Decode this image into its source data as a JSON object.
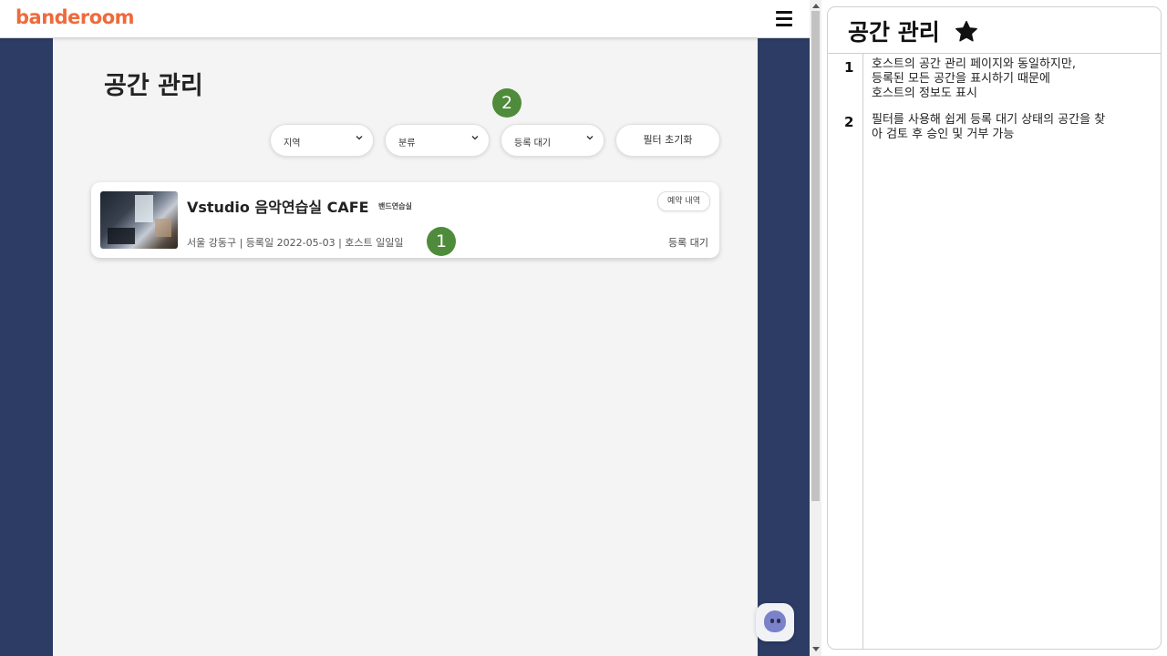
{
  "header": {
    "logo": "banderoom"
  },
  "page": {
    "title": "공간 관리"
  },
  "filters": {
    "region": "지역",
    "category": "분류",
    "status": "등록 대기",
    "reset": "필터 초기화"
  },
  "callouts": [
    "1",
    "2"
  ],
  "space_card": {
    "title": "Vstudio 음악연습실 CAFE",
    "category": "밴드연습실",
    "meta": "서울 강동구 | 등록일 2022-05-03 | 호스트 일일일",
    "button": "예약 내역",
    "status": "등록 대기"
  },
  "panel": {
    "title": "공간 관리",
    "notes": [
      {
        "num": "1",
        "lines": [
          "호스트의 공간 관리 페이지와 동일하지만,",
          "등록된 모든 공간을 표시하기 때문에",
          "호스트의 정보도 표시"
        ]
      },
      {
        "num": "2",
        "lines": [
          "필터를 사용해 쉽게 등록 대기 상태의 공간을 찾",
          "아 검토 후 승인 및 거부 가능"
        ]
      }
    ]
  },
  "colors": {
    "brand": "#ef6a3a",
    "side_bg": "#2c3c64",
    "callout": "#4e8b3a"
  }
}
